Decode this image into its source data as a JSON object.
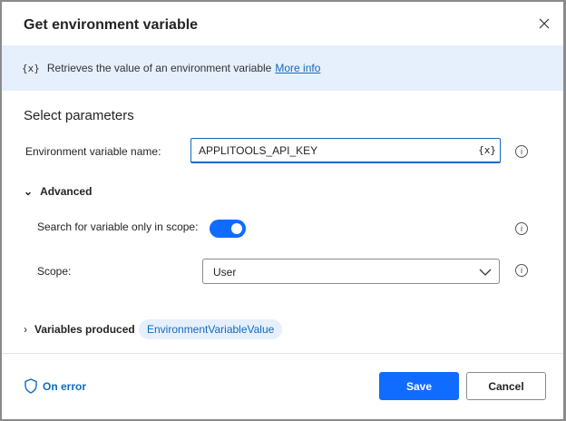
{
  "dialog": {
    "title": "Get environment variable",
    "close_icon": "close-icon"
  },
  "banner": {
    "icon": "{x}",
    "text": "Retrieves the value of an environment variable",
    "link": "More info"
  },
  "section_title": "Select parameters",
  "env_var": {
    "label": "Environment variable name:",
    "value": "APPLITOOLS_API_KEY",
    "var_icon": "{x}"
  },
  "advanced": {
    "label": "Advanced",
    "search_label": "Search for variable only in scope:",
    "search_on": true,
    "scope_label": "Scope:",
    "scope_value": "User"
  },
  "variables": {
    "label": "Variables produced",
    "value": "EnvironmentVariableValue"
  },
  "footer": {
    "on_error": "On error",
    "save": "Save",
    "cancel": "Cancel"
  },
  "colors": {
    "accent": "#0f6cff",
    "banner": "#e6effc",
    "link": "#0f6cbd"
  }
}
